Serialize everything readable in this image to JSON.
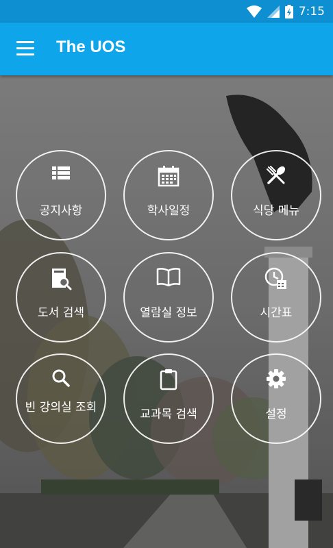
{
  "status_bar": {
    "time": "7:15"
  },
  "app_bar": {
    "title": "The UOS"
  },
  "tiles": [
    {
      "label": "공지사항",
      "icon": "list-icon"
    },
    {
      "label": "학사일정",
      "icon": "calendar-icon"
    },
    {
      "label": "식당 메뉴",
      "icon": "restaurant-icon"
    },
    {
      "label": "도서 검색",
      "icon": "book-search-icon"
    },
    {
      "label": "열람실 정보",
      "icon": "open-book-icon"
    },
    {
      "label": "시간표",
      "icon": "clock-calendar-icon"
    },
    {
      "label": "빈 강의실 조회",
      "icon": "search-icon"
    },
    {
      "label": "교과목 검색",
      "icon": "clipboard-icon"
    },
    {
      "label": "설정",
      "icon": "gear-icon"
    }
  ],
  "colors": {
    "status_bar": "#0d8fd1",
    "app_bar": "#0ea5ea"
  }
}
